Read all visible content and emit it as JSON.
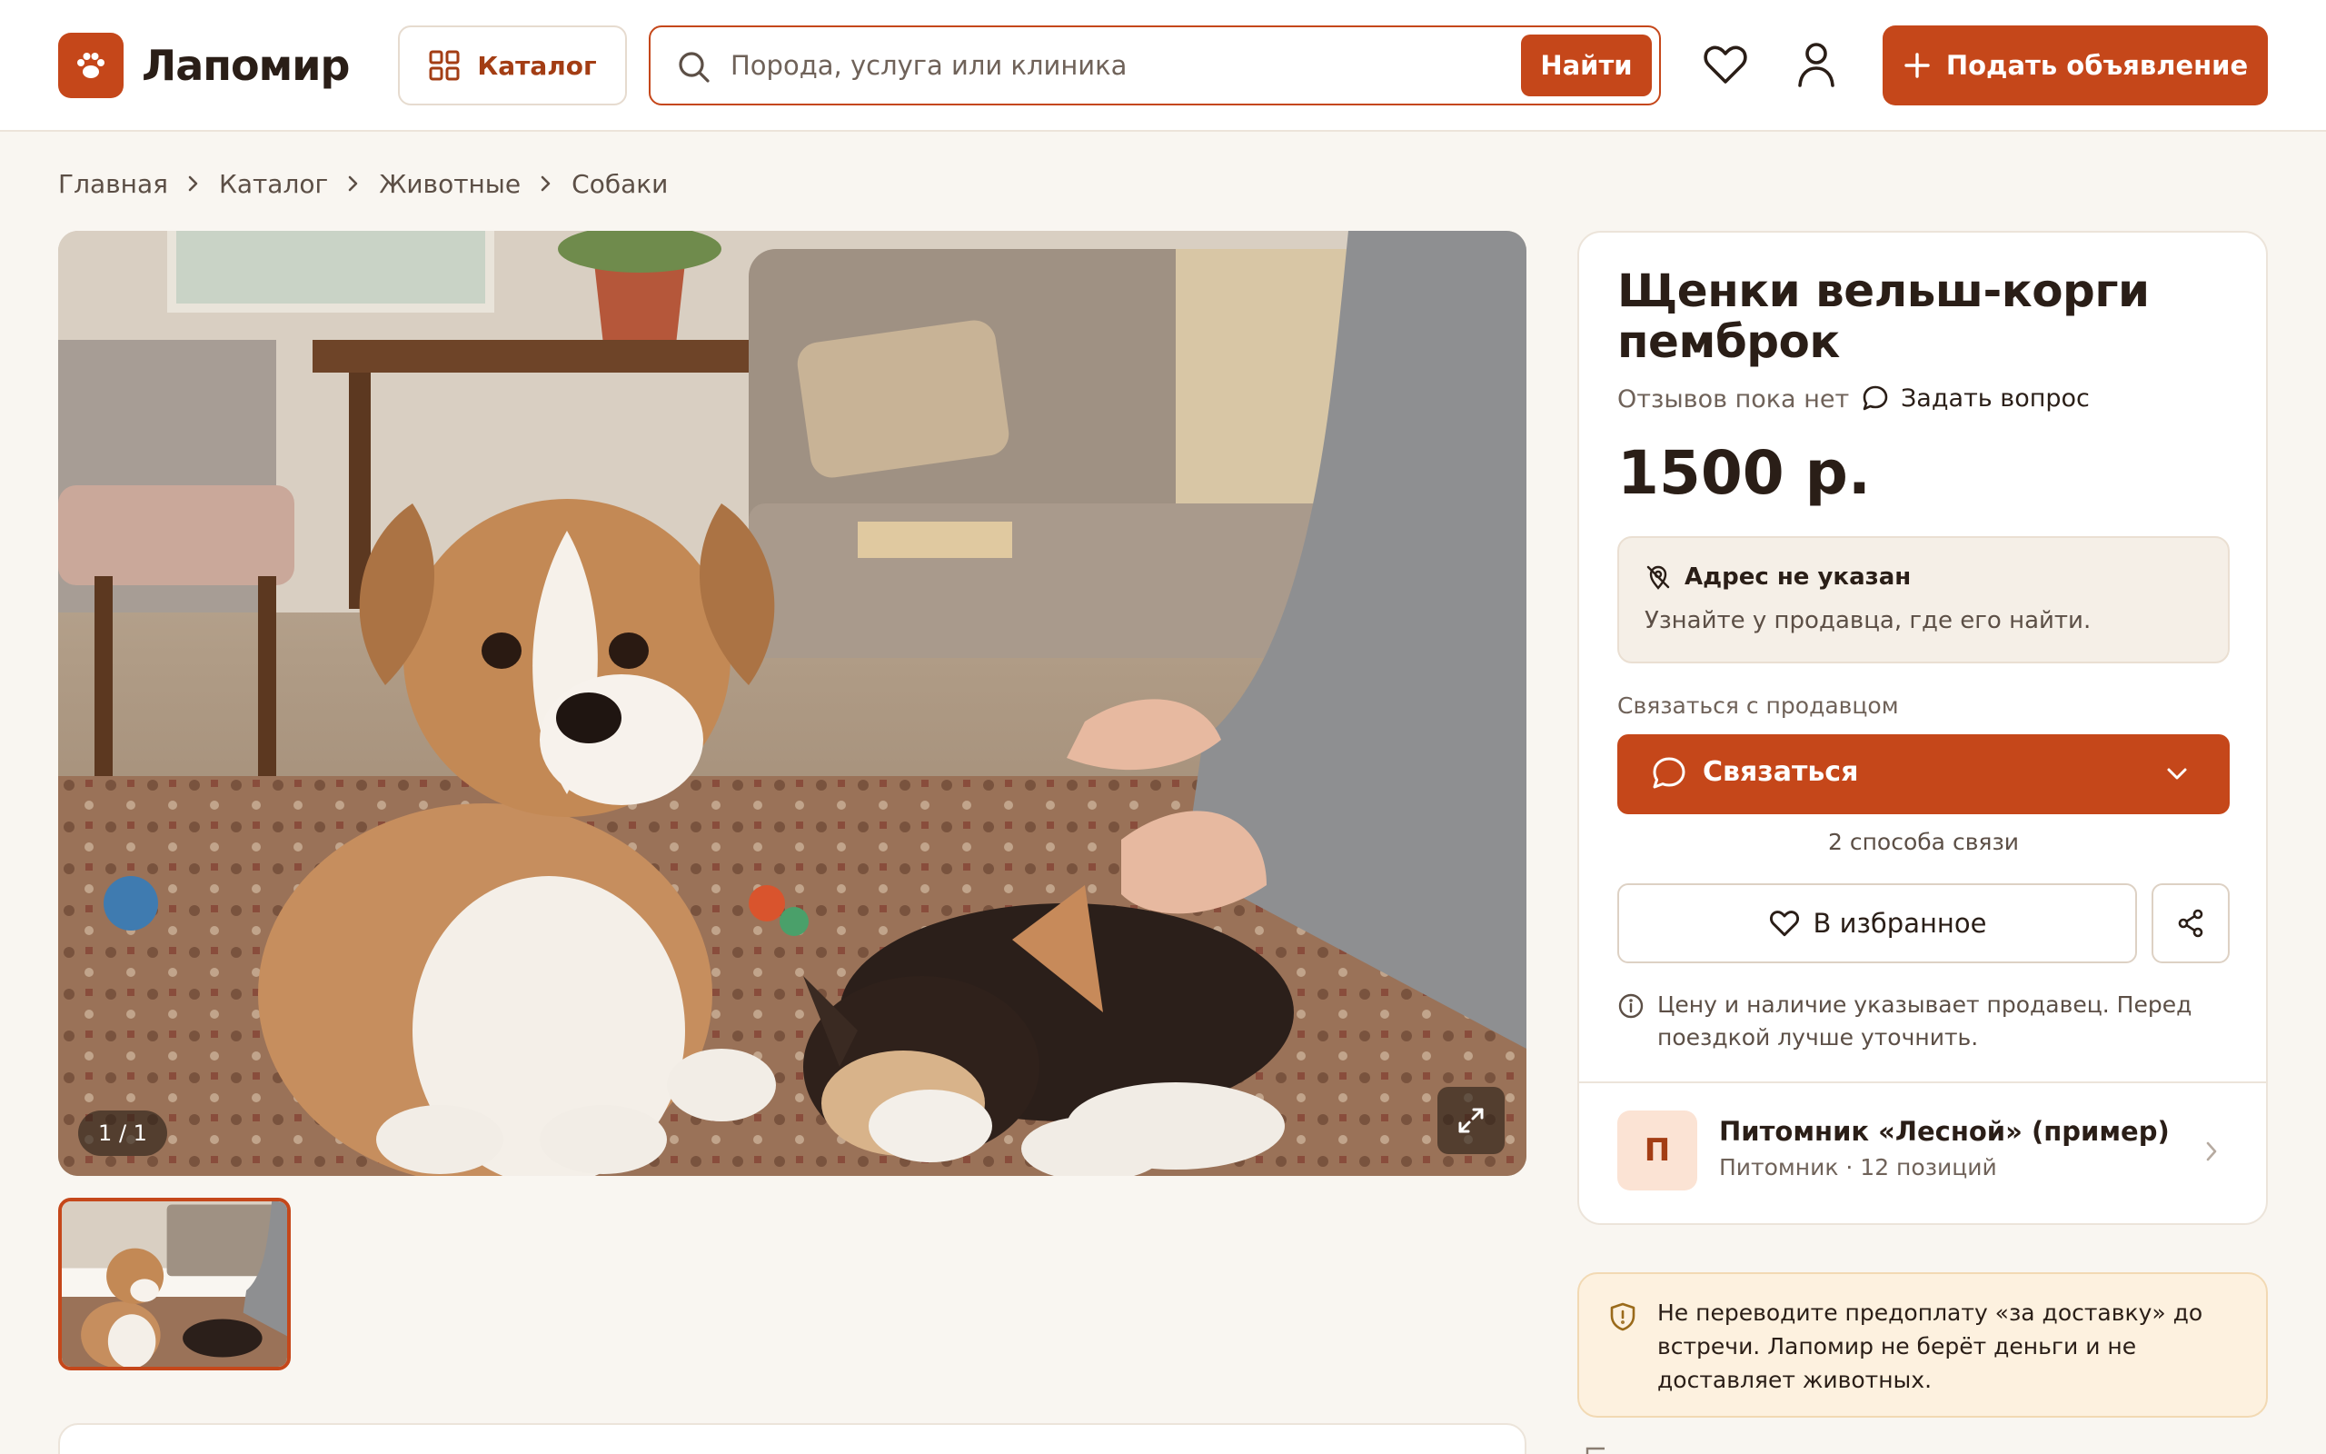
{
  "header": {
    "logo_text": "Лапомир",
    "catalog_label": "Каталог",
    "search_placeholder": "Порода, услуга или клиника",
    "search_button": "Найти",
    "post_ad_label": "Подать объявление"
  },
  "breadcrumb": [
    "Главная",
    "Каталог",
    "Животные",
    "Собаки"
  ],
  "gallery": {
    "counter": "1 / 1"
  },
  "listing": {
    "title": "Щенки вельш-корги пемброк",
    "reviews": "Отзывов пока нет",
    "ask_question": "Задать вопрос",
    "price": "1500 р.",
    "address_title": "Адрес не указан",
    "address_text": "Узнайте у продавца, где его найти.",
    "contact_label": "Связаться с продавцом",
    "contact_button": "Связаться",
    "contact_ways": "2 способа связи",
    "favorite_button": "В избранное",
    "price_note": "Цену и наличие указывает продавец. Перед поездкой лучше уточнить."
  },
  "seller": {
    "initial": "П",
    "name": "Питомник «Лесной» (пример)",
    "meta": "Питомник · 12 позиций"
  },
  "warning": {
    "text": "Не переводите предоплату «за доставку» до встречи. Лапомир не берёт деньги и не доставляет животных."
  },
  "colors": {
    "accent": "#c5471a",
    "page_bg": "#f9f6f1",
    "warning_bg": "#fdf1df"
  },
  "icons": {
    "logo": "paw-icon",
    "catalog": "grid-icon",
    "search": "search-icon",
    "favorites": "heart-icon",
    "profile": "user-icon",
    "post": "plus-icon",
    "expand": "expand-icon",
    "chat": "chat-icon",
    "share": "share-icon",
    "info": "info-icon",
    "warning": "shield-icon"
  }
}
